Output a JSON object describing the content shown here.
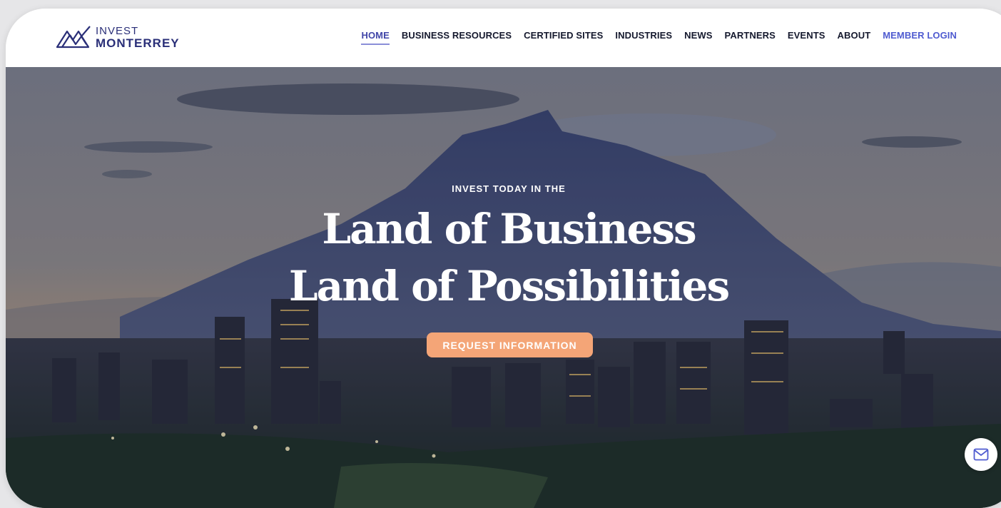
{
  "brand": {
    "line1": "INVEST",
    "line2": "MONTERREY",
    "color": "#2a2f78"
  },
  "nav": {
    "items": [
      {
        "label": "HOME",
        "active": true
      },
      {
        "label": "BUSINESS RESOURCES"
      },
      {
        "label": "CERTIFIED SITES"
      },
      {
        "label": "INDUSTRIES"
      },
      {
        "label": "NEWS"
      },
      {
        "label": "PARTNERS"
      },
      {
        "label": "EVENTS"
      },
      {
        "label": "ABOUT"
      },
      {
        "label": "MEMBER LOGIN"
      }
    ]
  },
  "hero": {
    "kicker": "INVEST TODAY IN THE",
    "headline_line1": "Land of Business",
    "headline_line2": "Land of Possibilities",
    "cta_label": "REQUEST INFORMATION",
    "cta_color": "#f4a577"
  },
  "floating": {
    "icon": "mail-icon"
  }
}
